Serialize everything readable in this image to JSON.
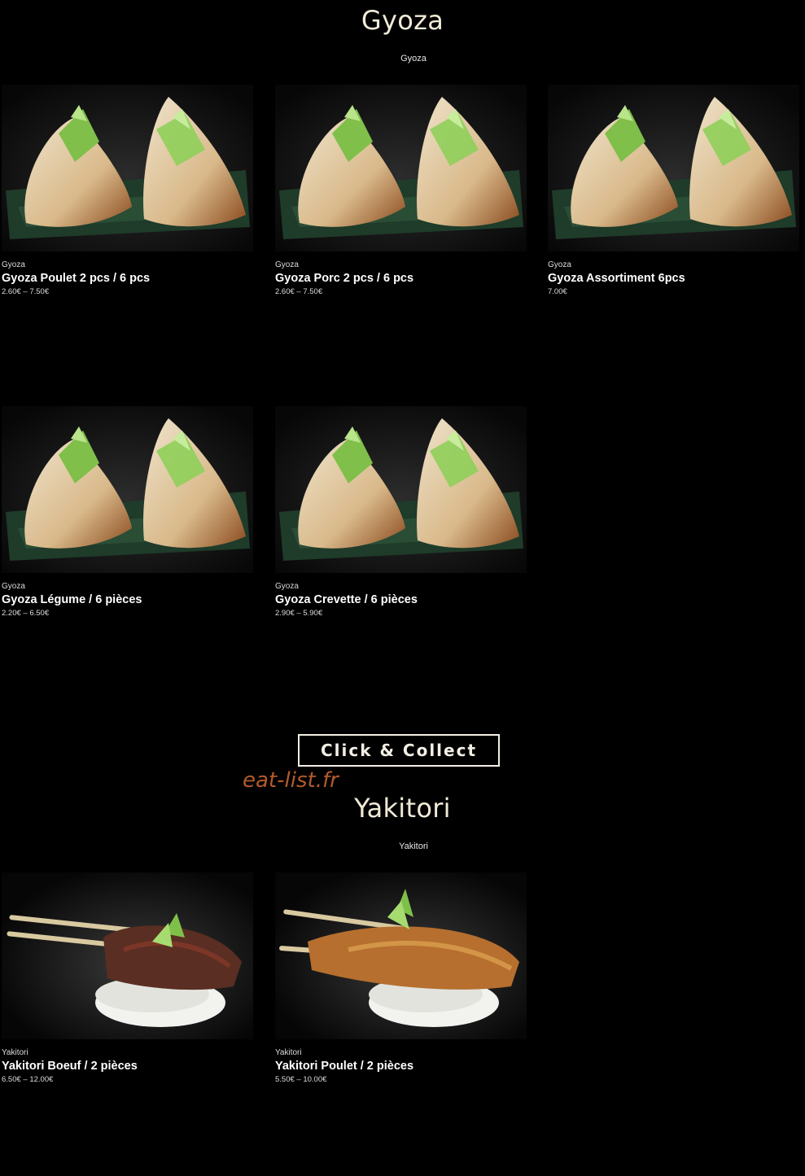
{
  "gyoza_section": {
    "title": "Gyoza",
    "subtitle": "Gyoza",
    "products": [
      {
        "category": "Gyoza",
        "name": "Gyoza Poulet 2 pcs / 6 pcs",
        "price": "2.60€ – 7.50€",
        "image": "gyoza-photo"
      },
      {
        "category": "Gyoza",
        "name": "Gyoza Porc 2 pcs / 6 pcs",
        "price": "2.60€ – 7.50€",
        "image": "gyoza-photo"
      },
      {
        "category": "Gyoza",
        "name": "Gyoza Assortiment 6pcs",
        "price": "7.00€",
        "image": "gyoza-photo"
      },
      {
        "category": "Gyoza",
        "name": "Gyoza Légume / 6 pièces",
        "price": "2.20€ – 6.50€",
        "image": "gyoza-photo"
      },
      {
        "category": "Gyoza",
        "name": "Gyoza Crevette / 6 pièces",
        "price": "2.90€ – 5.90€",
        "image": "gyoza-photo"
      }
    ]
  },
  "click_collect": {
    "label": "Click & Collect"
  },
  "watermark": "eat-list.fr",
  "yakitori_section": {
    "title": "Yakitori",
    "subtitle": "Yakitori",
    "products": [
      {
        "category": "Yakitori",
        "name": "Yakitori Boeuf / 2 pièces",
        "price": "6.50€ – 12.00€",
        "image": "beef-skewer-photo"
      },
      {
        "category": "Yakitori",
        "name": "Yakitori Poulet / 2 pièces",
        "price": "5.50€ – 10.00€",
        "image": "chicken-skewer-photo"
      }
    ]
  },
  "colors": {
    "background": "#000000",
    "title": "#f1ead8",
    "watermark": "#b25a2b"
  }
}
